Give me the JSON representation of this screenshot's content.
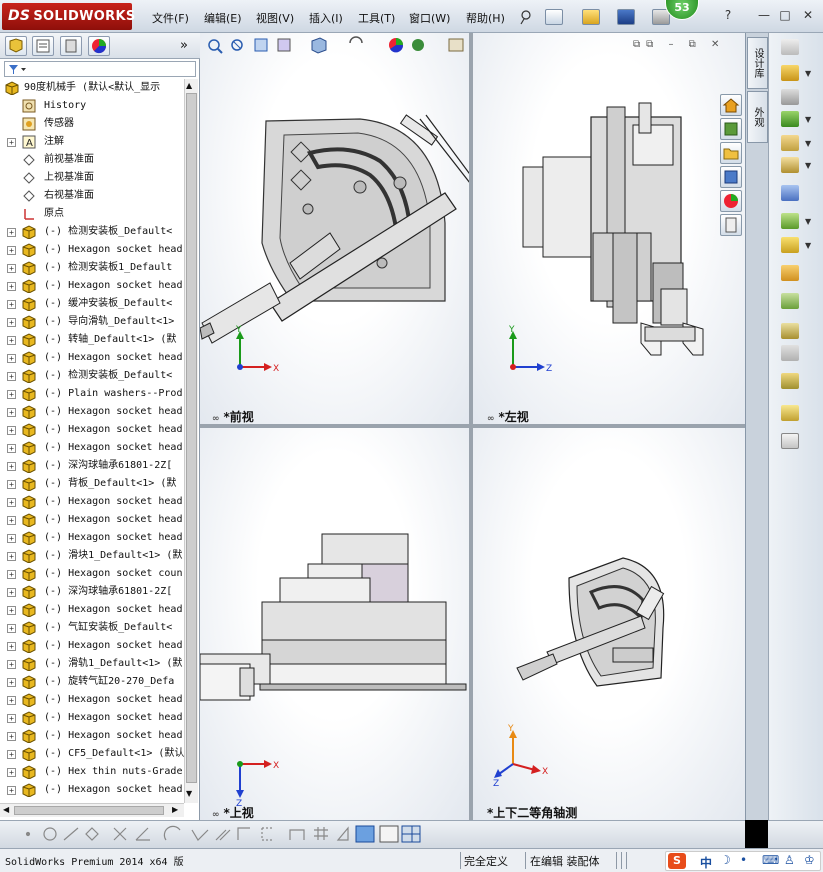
{
  "app": {
    "brand": "SOLIDWORKS",
    "brand_prefix": "DS",
    "notification_count": "53"
  },
  "menu": [
    "文件(F)",
    "编辑(E)",
    "视图(V)",
    "插入(I)",
    "工具(T)",
    "窗口(W)",
    "帮助(H)"
  ],
  "window_controls": {
    "help": "?",
    "minimize": "—",
    "restore": "□",
    "close": "✕"
  },
  "left_panel": {
    "collapse_label": "»",
    "root_label": "90度机械手  (默认<默认_显示",
    "tree_items": [
      {
        "label": "History",
        "icon": "history-icon",
        "expandable": false
      },
      {
        "label": "传感器",
        "icon": "sensor-icon",
        "expandable": false
      },
      {
        "label": "注解",
        "icon": "annotation-icon",
        "expandable": true
      },
      {
        "label": "前视基准面",
        "icon": "plane-icon",
        "expandable": false
      },
      {
        "label": "上视基准面",
        "icon": "plane-icon",
        "expandable": false
      },
      {
        "label": "右视基准面",
        "icon": "plane-icon",
        "expandable": false
      },
      {
        "label": "原点",
        "icon": "origin-icon",
        "expandable": false
      },
      {
        "label": "(-) 检测安装板_Default<",
        "icon": "part-icon",
        "expandable": true
      },
      {
        "label": "(-) Hexagon socket head",
        "icon": "part-icon",
        "expandable": true
      },
      {
        "label": "(-) 检测安装板1_Default",
        "icon": "part-icon",
        "expandable": true
      },
      {
        "label": "(-) Hexagon socket head",
        "icon": "part-icon",
        "expandable": true
      },
      {
        "label": "(-) 缓冲安装板_Default<",
        "icon": "part-icon",
        "expandable": true
      },
      {
        "label": "(-) 导向滑轨_Default<1>",
        "icon": "part-icon",
        "expandable": true
      },
      {
        "label": "(-) 转轴_Default<1> (默",
        "icon": "part-icon",
        "expandable": true
      },
      {
        "label": "(-) Hexagon socket head",
        "icon": "part-icon",
        "expandable": true
      },
      {
        "label": "(-) 检测安装板_Default<",
        "icon": "part-icon",
        "expandable": true
      },
      {
        "label": "(-) Plain washers--Prod",
        "icon": "part-icon",
        "expandable": true
      },
      {
        "label": "(-) Hexagon socket head",
        "icon": "part-icon",
        "expandable": true
      },
      {
        "label": "(-) Hexagon socket head",
        "icon": "part-icon",
        "expandable": true
      },
      {
        "label": "(-) Hexagon socket head",
        "icon": "part-icon",
        "expandable": true
      },
      {
        "label": "(-) 深沟球轴承61801-2Z[",
        "icon": "part-icon",
        "expandable": true
      },
      {
        "label": "(-) 背板_Default<1> (默",
        "icon": "part-icon",
        "expandable": true
      },
      {
        "label": "(-) Hexagon socket head",
        "icon": "part-icon",
        "expandable": true
      },
      {
        "label": "(-) Hexagon socket head",
        "icon": "part-icon",
        "expandable": true
      },
      {
        "label": "(-) Hexagon socket head",
        "icon": "part-icon",
        "expandable": true
      },
      {
        "label": "(-) 滑块1_Default<1> (默",
        "icon": "part-icon",
        "expandable": true
      },
      {
        "label": "(-) Hexagon socket coun",
        "icon": "part-icon",
        "expandable": true
      },
      {
        "label": "(-) 深沟球轴承61801-2Z[",
        "icon": "part-icon",
        "expandable": true
      },
      {
        "label": "(-) Hexagon socket head",
        "icon": "part-icon",
        "expandable": true
      },
      {
        "label": "(-) 气缸安装板_Default<",
        "icon": "part-icon",
        "expandable": true
      },
      {
        "label": "(-) Hexagon socket head",
        "icon": "part-icon",
        "expandable": true
      },
      {
        "label": "(-) 滑轨1_Default<1> (默",
        "icon": "part-icon",
        "expandable": true
      },
      {
        "label": "(-) 旋转气缸20-270_Defa",
        "icon": "part-icon",
        "expandable": true
      },
      {
        "label": "(-) Hexagon socket head",
        "icon": "part-icon",
        "expandable": true
      },
      {
        "label": "(-) Hexagon socket head",
        "icon": "part-icon",
        "expandable": true
      },
      {
        "label": "(-) Hexagon socket head",
        "icon": "part-icon",
        "expandable": true
      },
      {
        "label": "(-) CF5_Default<1> (默认",
        "icon": "part-icon",
        "expandable": true
      },
      {
        "label": "(-) Hex thin nuts-Grade",
        "icon": "part-icon",
        "expandable": true
      },
      {
        "label": "(-) Hexagon socket head",
        "icon": "part-icon",
        "expandable": true
      }
    ]
  },
  "viewports": {
    "front": "*前视",
    "left": "*左视",
    "top": "*上视",
    "iso": "*上下二等角轴测"
  },
  "axes": {
    "x": "X",
    "y": "Y",
    "z": "Z"
  },
  "vertical_tabs": [
    "设计库",
    "外观"
  ],
  "status_bar": {
    "product": "SolidWorks Premium 2014 x64 版",
    "state": "完全定义",
    "mode": "在编辑 装配体",
    "ime_label": "中"
  },
  "colors": {
    "brand_red": "#b81c15",
    "axis_x": "#d42020",
    "axis_y": "#1a9a1a",
    "axis_z": "#2040d0",
    "part_yellow": "#e8b820"
  }
}
